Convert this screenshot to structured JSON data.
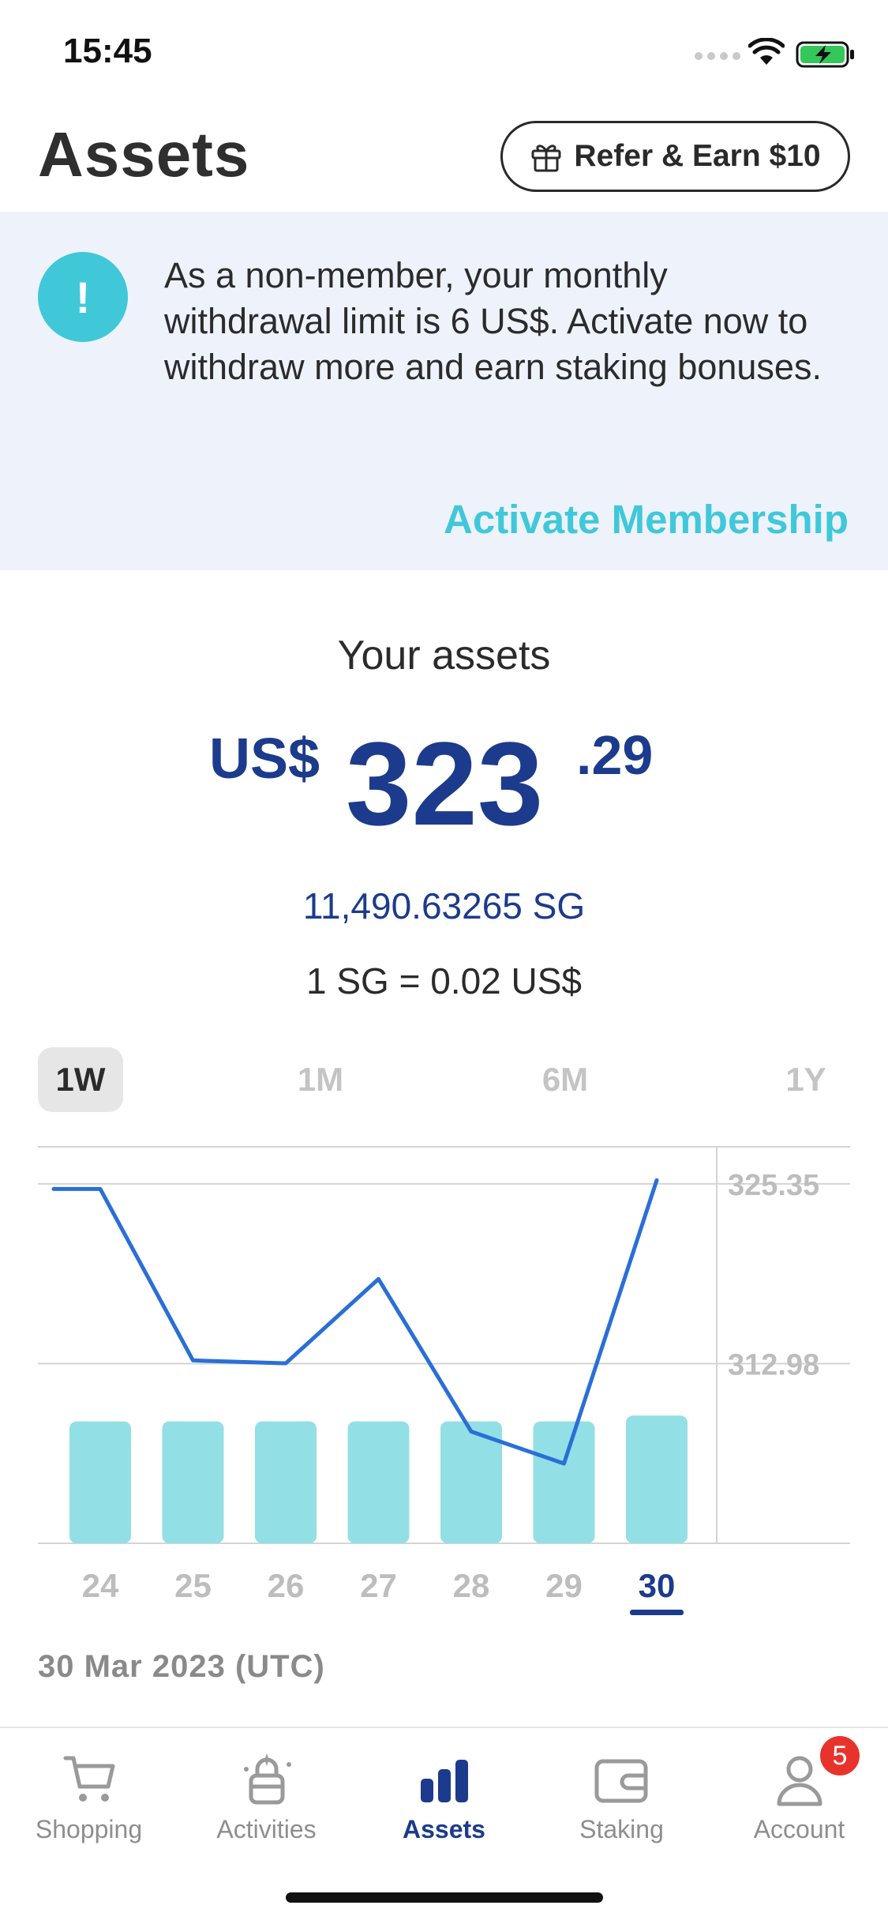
{
  "status_bar": {
    "time": "15:45"
  },
  "header": {
    "title": "Assets",
    "refer_label": "Refer & Earn $10"
  },
  "banner": {
    "message": "As a non-member, your monthly withdrawal limit is 6 US$. Activate now to withdraw more and earn staking bonuses.",
    "alert_symbol": "!",
    "action_label": "Activate Membership"
  },
  "summary": {
    "label": "Your assets",
    "currency": "US$",
    "amount_whole": "323",
    "amount_cents": ".29",
    "sg_amount": "11,490.63265 SG",
    "rate": "1 SG = 0.02 US$"
  },
  "range_tabs": [
    {
      "label": "1W",
      "active": true
    },
    {
      "label": "1M",
      "active": false
    },
    {
      "label": "6M",
      "active": false
    },
    {
      "label": "1Y",
      "active": false
    }
  ],
  "chart_data": {
    "type": "line",
    "categories": [
      "24",
      "25",
      "26",
      "27",
      "28",
      "29",
      "30"
    ],
    "series": [
      {
        "values": [
          325.0,
          313.2,
          313.0,
          318.8,
          308.3,
          306.1,
          325.6
        ]
      }
    ],
    "bars": [
      309.0,
      309.0,
      309.0,
      309.0,
      309.0,
      309.0,
      309.4
    ],
    "y_tick_labels": [
      "325.35",
      "312.98"
    ],
    "ylim": [
      300.61,
      327.9
    ],
    "selected_category": "30",
    "line_color": "#2a6fd6",
    "bar_color": "#93dfe6"
  },
  "chart_footer": {
    "date": "30 Mar 2023 (UTC)"
  },
  "bottom_nav": {
    "items": [
      {
        "label": "Shopping",
        "icon": "cart-icon",
        "active": false
      },
      {
        "label": "Activities",
        "icon": "activities-icon",
        "active": false
      },
      {
        "label": "Assets",
        "icon": "bar-chart-icon",
        "active": true
      },
      {
        "label": "Staking",
        "icon": "wallet-icon",
        "active": false
      },
      {
        "label": "Account",
        "icon": "person-icon",
        "active": false
      }
    ],
    "account_badge": "5"
  },
  "colors": {
    "primary": "#1c3b8c",
    "accent": "#40c8d9",
    "banner_bg": "#eef2fb",
    "badge": "#e8332d"
  }
}
